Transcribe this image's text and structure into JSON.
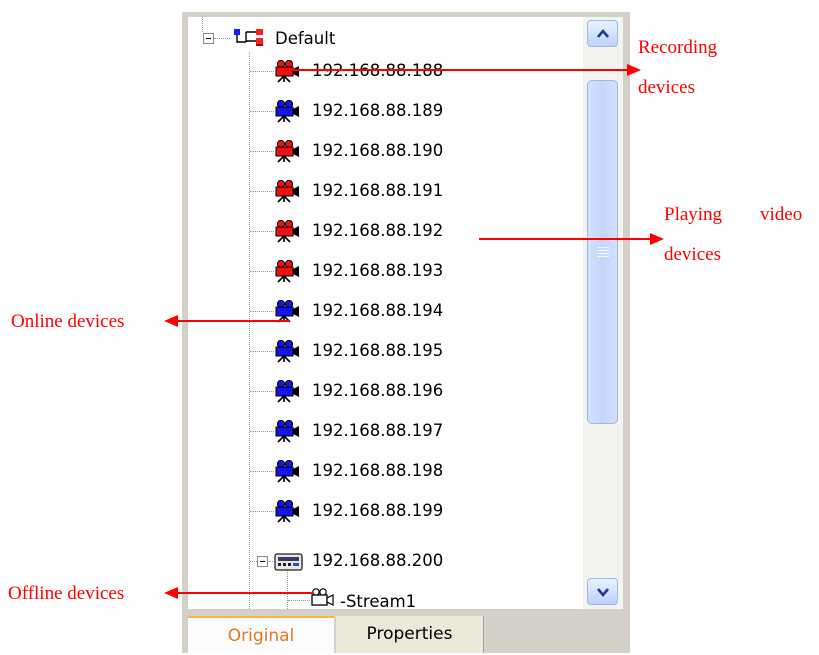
{
  "tree": {
    "root_label": "Default",
    "devices": [
      {
        "ip": "192.168.88.188",
        "state": "recording"
      },
      {
        "ip": "192.168.88.189",
        "state": "online"
      },
      {
        "ip": "192.168.88.190",
        "state": "playing"
      },
      {
        "ip": "192.168.88.191",
        "state": "playing"
      },
      {
        "ip": "192.168.88.192",
        "state": "playing"
      },
      {
        "ip": "192.168.88.193",
        "state": "playing"
      },
      {
        "ip": "192.168.88.194",
        "state": "online"
      },
      {
        "ip": "192.168.88.195",
        "state": "online"
      },
      {
        "ip": "192.168.88.196",
        "state": "online"
      },
      {
        "ip": "192.168.88.197",
        "state": "online"
      },
      {
        "ip": "192.168.88.198",
        "state": "online"
      },
      {
        "ip": "192.168.88.199",
        "state": "online"
      }
    ],
    "dvr": {
      "ip": "192.168.88.200",
      "icon": "dvr-icon"
    },
    "stream": {
      "label": "-Stream1",
      "state": "offline"
    }
  },
  "tabs": {
    "original": "Original",
    "properties": "Properties"
  },
  "callouts": {
    "recording_1": "Recording",
    "recording_2": "devices",
    "playing_1": "Playing",
    "playing_2": "video",
    "playing_3": "devices",
    "online": "Online devices",
    "offline": "Offline devices"
  },
  "colors": {
    "online": "#1414e6",
    "playing": "#ee1111",
    "offline": "#ffffff",
    "callout": "#ff0000",
    "active_tab_text": "#e07820"
  }
}
